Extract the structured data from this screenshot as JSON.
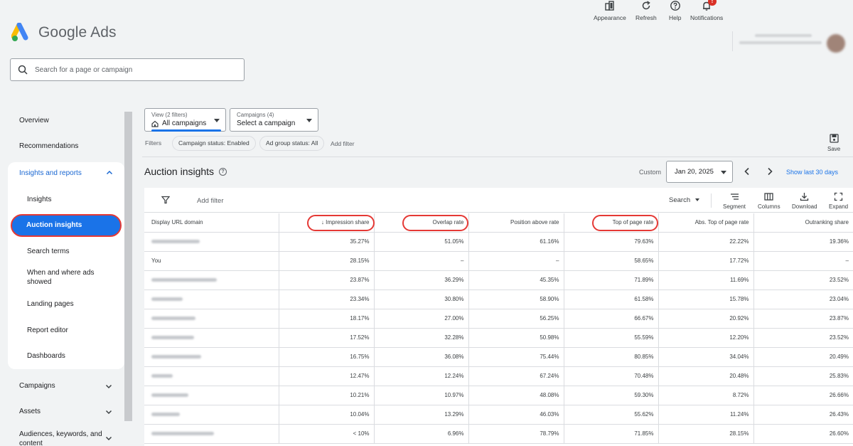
{
  "app": {
    "brand": "Google Ads"
  },
  "search": {
    "placeholder": "Search for a page or campaign"
  },
  "header_tools": [
    {
      "label": "Appearance",
      "icon": "appearance-icon"
    },
    {
      "label": "Refresh",
      "icon": "refresh-icon"
    },
    {
      "label": "Help",
      "icon": "help-icon"
    },
    {
      "label": "Notifications",
      "icon": "bell-icon",
      "badge": "!"
    }
  ],
  "sidebar": {
    "top_items": [
      "Overview",
      "Recommendations"
    ],
    "group": {
      "title": "Insights and reports",
      "items": [
        "Insights",
        "Auction insights",
        "Search terms",
        "When and where ads showed",
        "Landing pages",
        "Report editor",
        "Dashboards"
      ],
      "active": "Auction insights"
    },
    "bottom_items": [
      "Campaigns",
      "Assets",
      "Audiences, keywords, and content"
    ]
  },
  "view_selector": {
    "small": "View (2 filters)",
    "main": "All campaigns"
  },
  "campaign_selector": {
    "small": "Campaigns (4)",
    "main": "Select a campaign"
  },
  "filters": {
    "label": "Filters",
    "chips": [
      "Campaign status: Enabled",
      "Ad group status: All"
    ],
    "add": "Add filter"
  },
  "save_label": "Save",
  "page": {
    "title": "Auction insights",
    "help": "?",
    "date_mode": "Custom",
    "date": "Jan 20, 2025",
    "show_last": "Show last 30 days"
  },
  "table_toolbar": {
    "add_filter": "Add filter",
    "search": "Search",
    "buttons": [
      "Segment",
      "Columns",
      "Download",
      "Expand"
    ]
  },
  "table": {
    "columns": [
      "Display URL domain",
      "Impression share",
      "Overlap rate",
      "Position above rate",
      "Top of page rate",
      "Abs. Top of page rate",
      "Outranking share"
    ],
    "sort_indicator": "↓",
    "highlighted_columns": [
      "Impression share",
      "Overlap rate",
      "Top of page rate"
    ],
    "rows": [
      {
        "domain": "",
        "blurred": true,
        "values": [
          "35.27%",
          "51.05%",
          "61.16%",
          "79.63%",
          "22.22%",
          "19.36%"
        ]
      },
      {
        "domain": "You",
        "blurred": false,
        "values": [
          "28.15%",
          "–",
          "–",
          "58.65%",
          "17.72%",
          "–"
        ]
      },
      {
        "domain": "",
        "blurred": true,
        "values": [
          "23.87%",
          "36.29%",
          "45.35%",
          "71.89%",
          "11.69%",
          "23.52%"
        ]
      },
      {
        "domain": "",
        "blurred": true,
        "values": [
          "23.34%",
          "30.80%",
          "58.90%",
          "61.58%",
          "15.78%",
          "23.04%"
        ]
      },
      {
        "domain": "",
        "blurred": true,
        "values": [
          "18.17%",
          "27.00%",
          "56.25%",
          "66.67%",
          "20.92%",
          "23.87%"
        ]
      },
      {
        "domain": "",
        "blurred": true,
        "values": [
          "17.52%",
          "32.28%",
          "50.98%",
          "55.59%",
          "12.20%",
          "23.52%"
        ]
      },
      {
        "domain": "",
        "blurred": true,
        "values": [
          "16.75%",
          "36.08%",
          "75.44%",
          "80.85%",
          "34.04%",
          "20.49%"
        ]
      },
      {
        "domain": "",
        "blurred": true,
        "values": [
          "12.47%",
          "12.24%",
          "67.24%",
          "70.48%",
          "20.48%",
          "25.83%"
        ]
      },
      {
        "domain": "",
        "blurred": true,
        "values": [
          "10.21%",
          "10.97%",
          "48.08%",
          "59.30%",
          "8.72%",
          "26.66%"
        ]
      },
      {
        "domain": "",
        "blurred": true,
        "values": [
          "10.04%",
          "13.29%",
          "46.03%",
          "55.62%",
          "11.24%",
          "26.43%"
        ]
      },
      {
        "domain": "",
        "blurred": true,
        "values": [
          "< 10%",
          "6.96%",
          "78.79%",
          "71.85%",
          "28.15%",
          "26.60%"
        ]
      }
    ]
  },
  "colors": {
    "accent": "#1a73e8",
    "highlight_ring": "#e53935",
    "background": "#f1f3f4"
  }
}
